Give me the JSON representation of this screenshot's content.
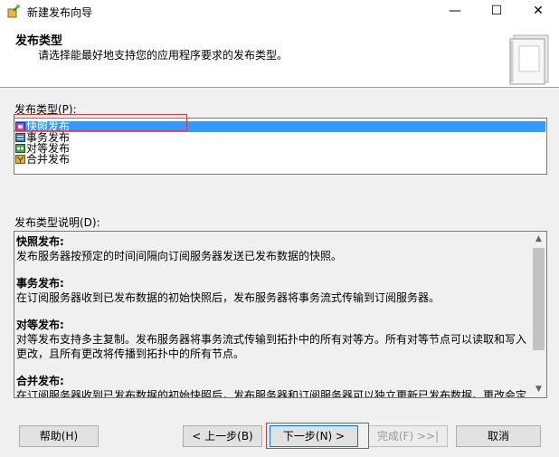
{
  "window": {
    "title": "新建发布向导",
    "controls": {
      "minimize": "—",
      "maximize": "☐",
      "close": "✕"
    }
  },
  "header": {
    "title": "发布类型",
    "subtitle": "请选择能最好地支持您的应用程序要求的发布类型。"
  },
  "publication_types": {
    "label": "发布类型(P):",
    "items": [
      {
        "label": "快照发布",
        "icon": "snapshot-publication-icon",
        "selected": true
      },
      {
        "label": "事务发布",
        "icon": "transactional-publication-icon",
        "selected": false
      },
      {
        "label": "对等发布",
        "icon": "peer-to-peer-publication-icon",
        "selected": false
      },
      {
        "label": "合并发布",
        "icon": "merge-publication-icon",
        "selected": false
      }
    ]
  },
  "description": {
    "label": "发布类型说明(D):",
    "entries": [
      {
        "title": "快照发布:",
        "text": "发布服务器按预定的时间间隔向订阅服务器发送已发布数据的快照。"
      },
      {
        "title": "事务发布:",
        "text": "在订阅服务器收到已发布数据的初始快照后，发布服务器将事务流式传输到订阅服务器。"
      },
      {
        "title": "对等发布:",
        "text": "对等发布支持多主复制。发布服务器将事务流式传输到拓扑中的所有对等方。所有对等节点可以读取和写入更改，且所有更改将传播到拓扑中的所有节点。"
      },
      {
        "title": "合并发布:",
        "text": "在订阅服务器收到已发布数据的初始快照后，发布服务器和订阅服务器可以独立更新已发布数据。更改会定期合并。"
      }
    ]
  },
  "buttons": {
    "help": "帮助(H)",
    "back": "< 上一步(B)",
    "next": "下一步(N) >",
    "finish": "完成(F) >>|",
    "cancel": "取消"
  },
  "colors": {
    "selection": "#3399ff",
    "highlight_outline": "#e0393e",
    "default_button_border": "#0078d7"
  }
}
